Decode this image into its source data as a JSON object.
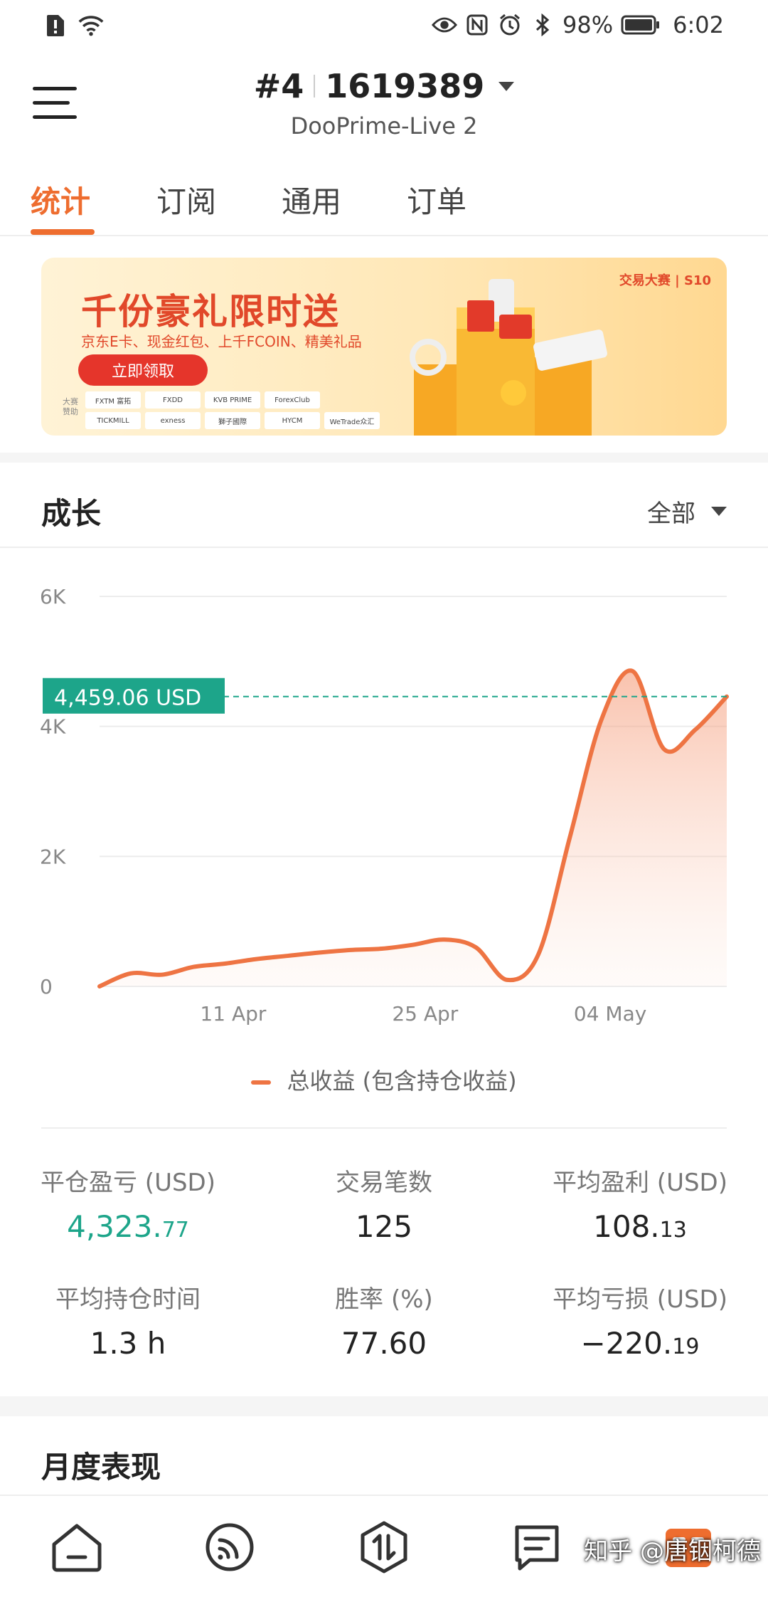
{
  "status_bar": {
    "battery": "98%",
    "time": "6:02"
  },
  "header": {
    "account_number": "#4",
    "account_id": "1619389",
    "server": "DooPrime-Live 2"
  },
  "tabs": [
    {
      "label": "统计",
      "active": true
    },
    {
      "label": "订阅",
      "active": false
    },
    {
      "label": "通用",
      "active": false
    },
    {
      "label": "订单",
      "active": false
    }
  ],
  "banner": {
    "title": "千份豪礼限时送",
    "subtitle": "京东E卡、现金红包、上千FCOIN、精美礼品",
    "button": "立即领取",
    "sponsor_label": "大赛赞助",
    "brand": "交易大赛 | S10",
    "sponsors": [
      "FXTM 富拓",
      "FXDD",
      "KVB PRIME",
      "ForexClub",
      "",
      "TICKMILL",
      "exness",
      "獅子國際",
      "HYCM",
      "WeTrade众汇"
    ]
  },
  "growth": {
    "title": "成长",
    "filter": "全部"
  },
  "chart_data": {
    "type": "area",
    "x_tick_labels": [
      "11 Apr",
      "25 Apr",
      "04 May"
    ],
    "y_tick_labels": [
      "0",
      "2K",
      "4K",
      "6K"
    ],
    "ylim": [
      0,
      6000
    ],
    "current_value_label": "4,459.06 USD",
    "current_value": 4459.06,
    "series": [
      {
        "name": "总收益 (包含持仓收益)",
        "color": "#ee7443",
        "values": [
          0,
          200,
          180,
          300,
          350,
          420,
          470,
          520,
          560,
          580,
          640,
          720,
          600,
          100,
          500,
          2300,
          4100,
          4850,
          3650,
          3950,
          4459.06
        ]
      }
    ],
    "legend": "总收益 (包含持仓收益)",
    "grid": true
  },
  "stats": [
    {
      "label": "平仓盈亏 (USD)",
      "value_main": "4,323.",
      "value_small": "77",
      "color": "green"
    },
    {
      "label": "交易笔数",
      "value_main": "125",
      "value_small": ""
    },
    {
      "label": "平均盈利 (USD)",
      "value_main": "108.",
      "value_small": "13"
    },
    {
      "label": "平均持仓时间",
      "value_main": "1.3 h",
      "value_small": ""
    },
    {
      "label": "胜率 (%)",
      "value_main": "77.60",
      "value_small": ""
    },
    {
      "label": "平均亏损 (USD)",
      "value_main": "−220.",
      "value_small": "19"
    }
  ],
  "monthly": {
    "title": "月度表现"
  },
  "bottom_nav": {
    "items": [
      "home-icon",
      "feed-icon",
      "trade-icon",
      "orders-icon",
      "profile-icon"
    ],
    "watermark": "知乎 @唐铟柯德"
  }
}
